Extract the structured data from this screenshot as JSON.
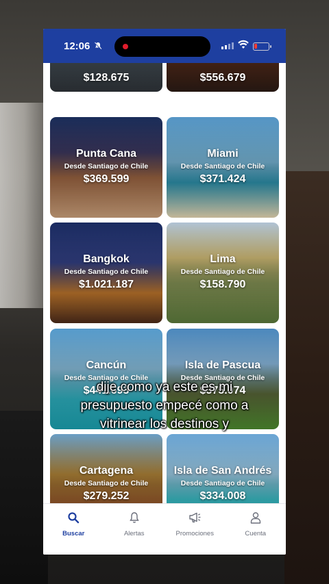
{
  "status": {
    "time": "12:06"
  },
  "destinations": [
    {
      "name": "",
      "from": "",
      "price": "$128.675"
    },
    {
      "name": "",
      "from": "",
      "price": "$556.679"
    },
    {
      "name": "Punta Cana",
      "from": "Desde Santiago de Chile",
      "price": "$369.599"
    },
    {
      "name": "Miami",
      "from": "Desde Santiago de Chile",
      "price": "$371.424"
    },
    {
      "name": "Bangkok",
      "from": "Desde Santiago de Chile",
      "price": "$1.021.187"
    },
    {
      "name": "Lima",
      "from": "Desde Santiago de Chile",
      "price": "$158.790"
    },
    {
      "name": "Cancún",
      "from": "Desde Santiago de Chile",
      "price": "$441.693"
    },
    {
      "name": "Isla de Pascua",
      "from": "Desde Santiago de Chile",
      "price": "$375.074"
    },
    {
      "name": "Cartagena",
      "from": "Desde Santiago de Chile",
      "price": "$279.252"
    },
    {
      "name": "Isla de San Andrés",
      "from": "Desde Santiago de Chile",
      "price": "$334.008"
    }
  ],
  "subtitle": {
    "line1": "dije como ya este es mi",
    "line2": "presupuesto empecé como a",
    "line3": "vitrinear los destinos y"
  },
  "tabs": [
    {
      "label": "Buscar",
      "icon": "search-icon"
    },
    {
      "label": "Alertas",
      "icon": "bell-icon"
    },
    {
      "label": "Promociones",
      "icon": "megaphone-icon"
    },
    {
      "label": "Cuenta",
      "icon": "user-icon"
    }
  ],
  "colors": {
    "brand": "#1e3fa0",
    "inactive": "#6b6f7b"
  }
}
